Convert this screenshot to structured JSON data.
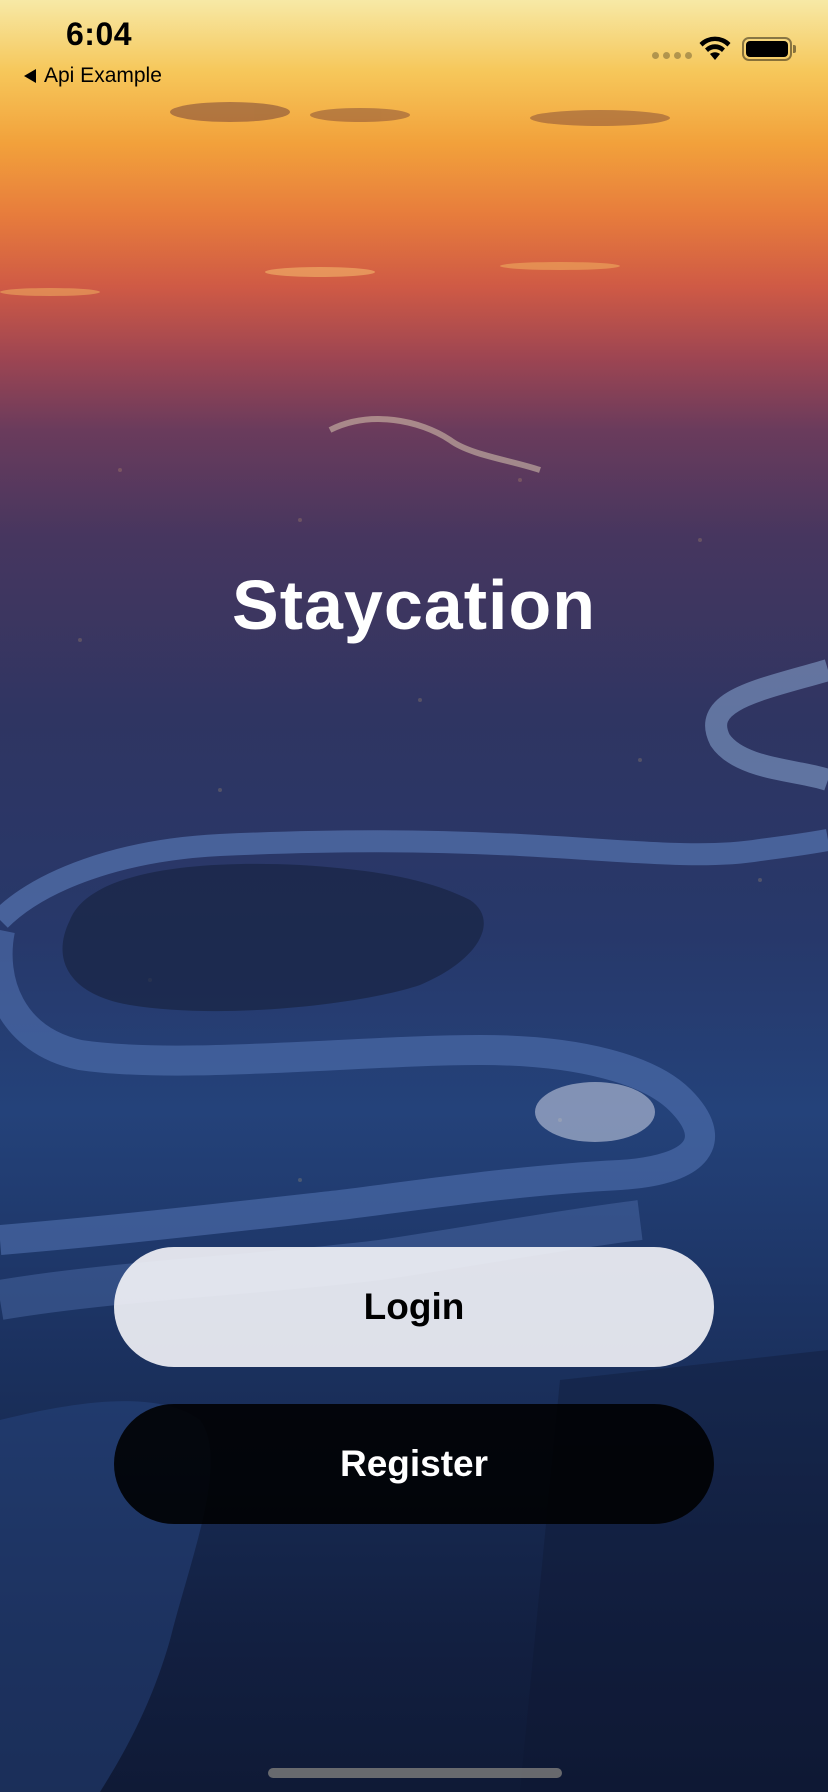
{
  "status_bar": {
    "time": "6:04",
    "back_app_label": "Api Example"
  },
  "app": {
    "title": "Staycation"
  },
  "actions": {
    "login_label": "Login",
    "register_label": "Register"
  },
  "background": {
    "icon": "city-river-aerial-image"
  }
}
